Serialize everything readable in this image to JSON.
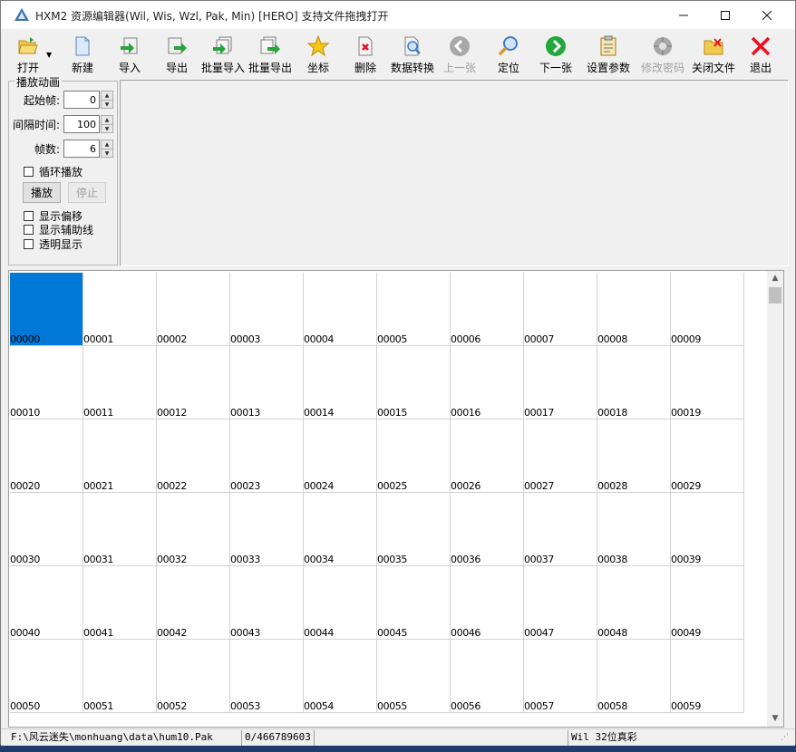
{
  "window": {
    "title": "HXM2 资源编辑器(Wil, Wis, Wzl, Pak, Min) [HERO] 支持文件拖拽打开"
  },
  "toolbar": {
    "buttons": [
      {
        "id": "open",
        "label": "打开",
        "icon": "folder-open-icon"
      },
      {
        "id": "new",
        "label": "新建",
        "icon": "new-file-icon"
      },
      {
        "id": "import",
        "label": "导入",
        "icon": "import-icon"
      },
      {
        "id": "export",
        "label": "导出",
        "icon": "export-icon"
      },
      {
        "id": "batch_import",
        "label": "批量导入",
        "icon": "batch-import-icon"
      },
      {
        "id": "batch_export",
        "label": "批量导出",
        "icon": "batch-export-icon"
      },
      {
        "id": "coords",
        "label": "坐标",
        "icon": "star-icon"
      },
      {
        "id": "delete",
        "label": "删除",
        "icon": "delete-file-icon"
      },
      {
        "id": "convert",
        "label": "数据转换",
        "icon": "data-convert-icon"
      },
      {
        "id": "prev",
        "label": "上一张",
        "icon": "arrow-left-icon",
        "disabled": true
      },
      {
        "id": "locate",
        "label": "定位",
        "icon": "magnifier-icon"
      },
      {
        "id": "next",
        "label": "下一张",
        "icon": "arrow-right-icon"
      },
      {
        "id": "settings",
        "label": "设置参数",
        "icon": "clipboard-icon"
      },
      {
        "id": "change_password",
        "label": "修改密码",
        "icon": "password-icon",
        "disabled": true
      },
      {
        "id": "close_file",
        "label": "关闭文件",
        "icon": "close-folder-icon"
      },
      {
        "id": "exit",
        "label": "退出",
        "icon": "exit-x-icon"
      }
    ]
  },
  "anim": {
    "legend": "播放动画",
    "start_frame_label": "起始帧:",
    "start_frame_value": "0",
    "interval_label": "间隔时间:",
    "interval_value": "100",
    "frames_label": "帧数:",
    "frames_value": "6",
    "loop_label": "循环播放",
    "play_label": "播放",
    "stop_label": "停止",
    "show_offset_label": "显示偏移",
    "show_guides_label": "显示辅助线",
    "transparent_label": "透明显示"
  },
  "grid": {
    "selected": "00000",
    "rows": [
      [
        "00000",
        "00001",
        "00002",
        "00003",
        "00004",
        "00005",
        "00006",
        "00007",
        "00008",
        "00009"
      ],
      [
        "00010",
        "00011",
        "00012",
        "00013",
        "00014",
        "00015",
        "00016",
        "00017",
        "00018",
        "00019"
      ],
      [
        "00020",
        "00021",
        "00022",
        "00023",
        "00024",
        "00025",
        "00026",
        "00027",
        "00028",
        "00029"
      ],
      [
        "00030",
        "00031",
        "00032",
        "00033",
        "00034",
        "00035",
        "00036",
        "00037",
        "00038",
        "00039"
      ],
      [
        "00040",
        "00041",
        "00042",
        "00043",
        "00044",
        "00045",
        "00046",
        "00047",
        "00048",
        "00049"
      ],
      [
        "00050",
        "00051",
        "00052",
        "00053",
        "00054",
        "00055",
        "00056",
        "00057",
        "00058",
        "00059"
      ]
    ]
  },
  "status": {
    "path": "F:\\风云迷失\\monhuang\\data\\hum10.Pak",
    "position": "0/466789603",
    "empty": "",
    "format": "Wil 32位真彩"
  },
  "colors": {
    "selection": "#0078d7",
    "exit_red": "#e81123",
    "nav_green": "#22a73b"
  }
}
